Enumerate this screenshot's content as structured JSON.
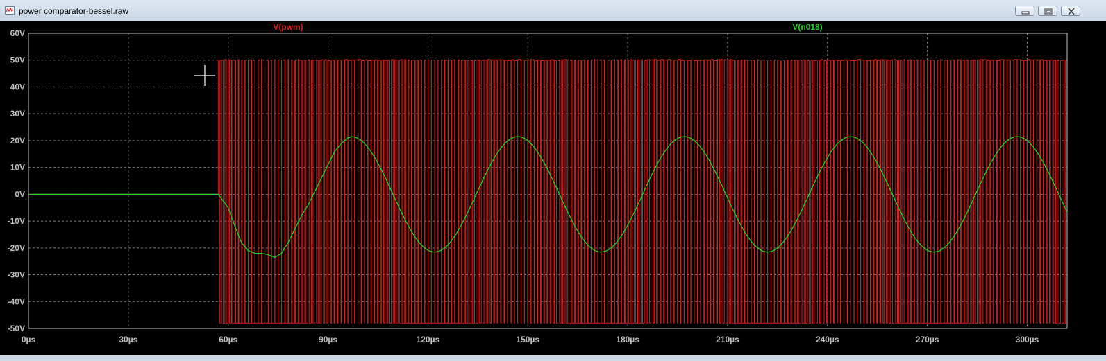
{
  "window": {
    "title": "power comparator-bessel.raw",
    "icon": "waveform-icon",
    "buttons": [
      "minimize-icon",
      "restore-icon",
      "close-icon"
    ]
  },
  "colors": {
    "background": "#000000",
    "grid": "#7f7f7f",
    "axis_text": "#c0c0c0",
    "pwm": "#d42020",
    "n018": "#22d422"
  },
  "chart_data": {
    "type": "line",
    "xlabel": "",
    "ylabel": "",
    "xlim": [
      0,
      312
    ],
    "ylim": [
      -50,
      60
    ],
    "grid": true,
    "x_ticks": [
      "0µs",
      "30µs",
      "60µs",
      "90µs",
      "120µs",
      "150µs",
      "180µs",
      "210µs",
      "240µs",
      "270µs",
      "300µs"
    ],
    "y_ticks": [
      "60V",
      "50V",
      "40V",
      "30V",
      "20V",
      "10V",
      "0V",
      "-10V",
      "-20V",
      "-30V",
      "-40V",
      "-50V"
    ],
    "series": [
      {
        "name": "V(pwm)",
        "color": "#d42020",
        "high_level": 50,
        "low_level": -48,
        "start_time": 57,
        "switching_period": 1,
        "sine_period": 50,
        "sine_amplitude": 21.5
      },
      {
        "name": "V(n018)",
        "color": "#22d422",
        "x": [
          0,
          57,
          60,
          62,
          64,
          66,
          68,
          70,
          72,
          74,
          76,
          78,
          80,
          82,
          84,
          86,
          88,
          90,
          92,
          94,
          96,
          97
        ],
        "y": [
          0,
          0,
          -5,
          -12,
          -18,
          -21,
          -22,
          -22,
          -22.5,
          -23.5,
          -22,
          -18,
          -13,
          -8,
          -4,
          1,
          6,
          11,
          16,
          19,
          21,
          21.5
        ],
        "steady_state": {
          "amplitude": 21.5,
          "period": 50,
          "peak_time": 97
        }
      }
    ]
  }
}
